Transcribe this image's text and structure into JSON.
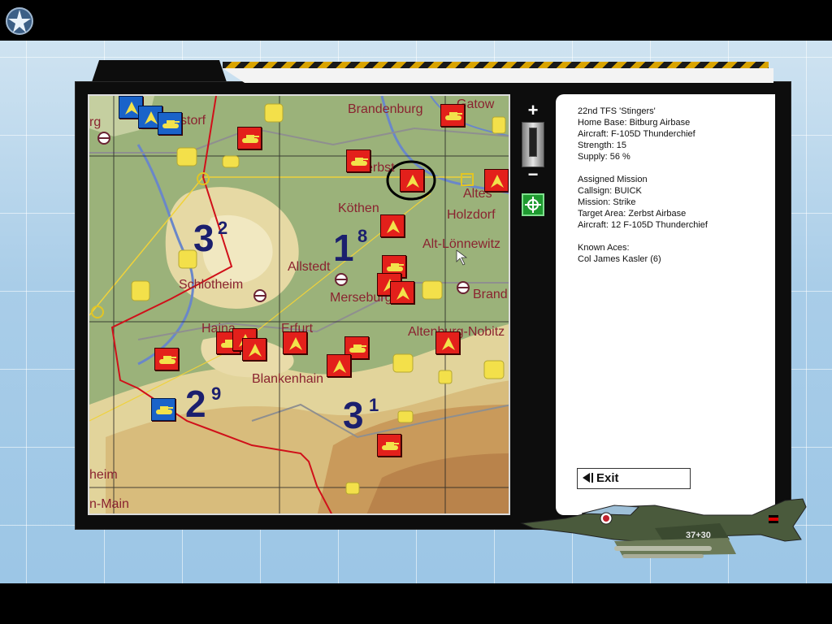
{
  "map": {
    "places": [
      {
        "name": "Brandenburg"
      },
      {
        "name": "Gatow"
      },
      {
        "name": "rg"
      },
      {
        "name": "storf"
      },
      {
        "name": "erbst"
      },
      {
        "name": "Altes"
      },
      {
        "name": "Köthen"
      },
      {
        "name": "Holzdorf"
      },
      {
        "name": "Alt-Lönnewitz"
      },
      {
        "name": "Allstedt"
      },
      {
        "name": "Schlotheim"
      },
      {
        "name": "Merseburg"
      },
      {
        "name": "Brand"
      },
      {
        "name": "Haina"
      },
      {
        "name": "Erfurt"
      },
      {
        "name": "Altenburg-Nobitz"
      },
      {
        "name": "Blankenhain"
      },
      {
        "name": "heim"
      },
      {
        "name": "n-Main"
      }
    ],
    "sectors": [
      {
        "main": "3",
        "sup": "2"
      },
      {
        "main": "1",
        "sup": "8"
      },
      {
        "main": "2",
        "sup": "9"
      },
      {
        "main": "3",
        "sup": "1"
      }
    ]
  },
  "controls": {
    "zoom_in": "+",
    "zoom_out": "−",
    "center_icon": "crosshair-icon"
  },
  "info": {
    "lines": [
      "22nd TFS 'Stingers'",
      "Home Base: Bitburg Airbase",
      "Aircraft: F-105D Thunderchief",
      "Strength: 15",
      "Supply: 56 %",
      "",
      "Assigned Mission",
      "Callsign: BUICK",
      "Mission: Strike",
      "Target Area: Zerbst Airbase",
      "Aircraft: 12 F-105D Thunderchief",
      "",
      "Known Aces:",
      "Col James Kasler (6)"
    ]
  },
  "exit": {
    "label": "Exit"
  },
  "aircraft": {
    "tail": "37+30"
  },
  "colors": {
    "enemy_unit": "#e3201b",
    "friendly_unit": "#1a63c9",
    "front_line": "#d0101a",
    "sector_number": "#1b1f6e",
    "place_label": "#8a2330"
  }
}
